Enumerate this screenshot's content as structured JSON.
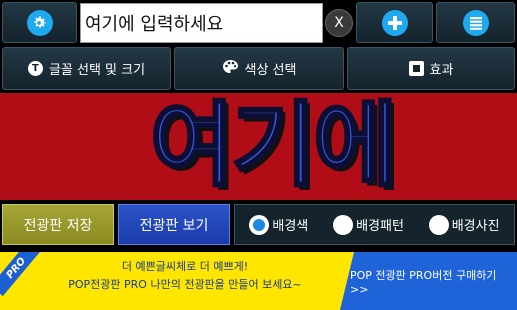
{
  "toolbar": {
    "input_value": "여기에 입력하세요",
    "clear_label": "X"
  },
  "tools": {
    "font_icon": "T",
    "font_label": "글꼴 선택 및 크기",
    "color_label": "색상 선택",
    "effect_label": "효과"
  },
  "canvas": {
    "text": "여기에",
    "bg_color": "#b00d16",
    "text_color": "#3357e6"
  },
  "actions": {
    "save_label": "전광판 저장",
    "view_label": "전광판 보기"
  },
  "background_options": [
    {
      "label": "배경색",
      "checked": true
    },
    {
      "label": "배경패턴",
      "checked": false
    },
    {
      "label": "배경사진",
      "checked": false
    }
  ],
  "ad": {
    "ribbon": "PRO",
    "line1": "더 예쁜글씨체로 더 예쁘게!",
    "line2": "POP전광판 PRO 나만의 전광판을 만들어 보세요~",
    "cta": "POP 전광판 PRO버전 구매하기 >>"
  },
  "icons": [
    "gear-icon",
    "plus-icon",
    "menu-list-icon",
    "clear-icon",
    "font-icon",
    "palette-icon",
    "effect-icon"
  ]
}
